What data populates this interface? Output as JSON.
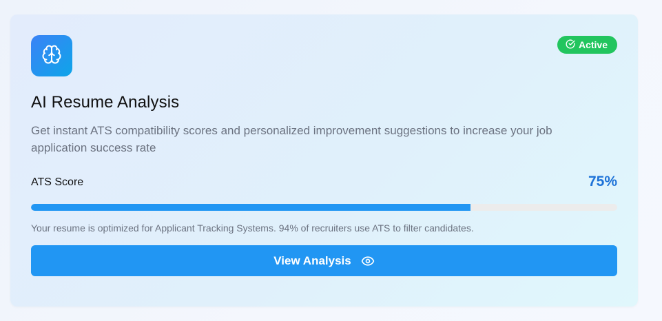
{
  "feature": {
    "icon": "brain-icon",
    "status": {
      "label": "Active",
      "icon": "check-circle-icon",
      "color": "#22c55e"
    },
    "title": "AI Resume Analysis",
    "description": "Get instant ATS compatibility scores and personalized improvement suggestions to increase your job application success rate"
  },
  "ats": {
    "label": "ATS Score",
    "value_text": "75%",
    "progress_fraction": 0.75,
    "note": "Your resume is optimized for Applicant Tracking Systems. 94% of recruiters use ATS to filter candidates."
  },
  "action": {
    "label": "View Analysis",
    "icon": "eye-icon",
    "color": "#2196f3"
  }
}
